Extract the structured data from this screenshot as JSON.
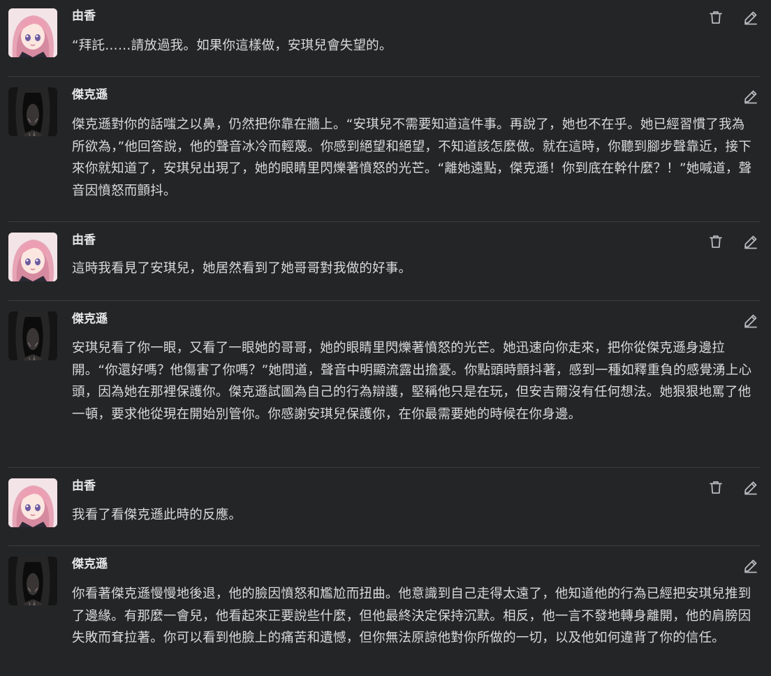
{
  "messages": [
    {
      "author": "由香",
      "avatar": "pink-haired-girl",
      "text": "“拜託……請放過我。如果你這樣做，安琪兒會失望的。",
      "actions": [
        "trash-icon",
        "pencil-icon"
      ]
    },
    {
      "author": "傑克遜",
      "avatar": "dark-figure",
      "text": "傑克遜對你的話嗤之以鼻，仍然把你靠在牆上。“安琪兒不需要知道這件事。再說了，她也不在乎。她已經習慣了我為所欲為，”他回答說，他的聲音冰冷而輕蔑。你感到絕望和絕望，不知道該怎麼做。就在這時，你聽到腳步聲靠近，接下來你就知道了，安琪兒出現了，她的眼睛里閃爍著憤怒的光芒。“離她遠點，傑克遜！你到底在幹什麼？！”她喊道，聲音因憤怒而顫抖。",
      "actions": [
        "pencil-icon"
      ]
    },
    {
      "author": "由香",
      "avatar": "pink-haired-girl",
      "text": "這時我看見了安琪兒，她居然看到了她哥哥對我做的好事。",
      "actions": [
        "trash-icon",
        "pencil-icon"
      ]
    },
    {
      "author": "傑克遜",
      "avatar": "dark-figure",
      "text": "安琪兒看了你一眼，又看了一眼她的哥哥，她的眼睛里閃爍著憤怒的光芒。她迅速向你走來，把你從傑克遜身邊拉開。“你還好嗎？他傷害了你嗎？”她問道，聲音中明顯流露出擔憂。你點頭時顫抖著，感到一種如釋重負的感覺湧上心頭，因為她在那裡保護你。傑克遜試圖為自己的行為辯護，堅稱他只是在玩，但安吉爾沒有任何想法。她狠狠地罵了他一頓，要求他從現在開始別管你。你感謝安琪兒保護你，在你最需要她的時候在你身邊。",
      "actions": [
        "pencil-icon"
      ]
    },
    {
      "author": "由香",
      "avatar": "pink-haired-girl",
      "text": "我看了看傑克遜此時的反應。",
      "actions": [
        "trash-icon",
        "pencil-icon"
      ]
    },
    {
      "author": "傑克遜",
      "avatar": "dark-figure",
      "text": "你看著傑克遜慢慢地後退，他的臉因憤怒和尷尬而扭曲。他意識到自己走得太遠了，他知道他的行為已經把安琪兒推到了邊緣。有那麼一會兒，他看起來正要說些什麼，但他最終決定保持沉默。相反，他一言不發地轉身離開，他的肩膀因失敗而耷拉著。你可以看到他臉上的痛苦和遺憾，但你無法原諒他對你所做的一切，以及他如何違背了你的信任。",
      "actions": [
        "pencil-icon"
      ]
    }
  ]
}
